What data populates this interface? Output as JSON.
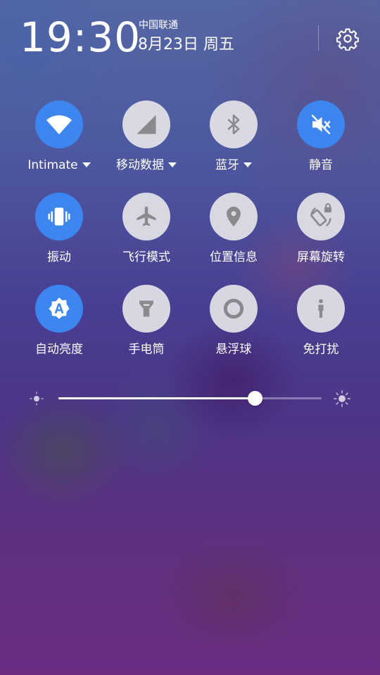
{
  "status": {
    "time": "19:30",
    "carrier": "中国联通",
    "date": "8月23日 周五",
    "settings_icon": "gear-icon"
  },
  "tiles": [
    {
      "label": "Intimate",
      "icon": "wifi-icon",
      "active": true,
      "has_dropdown": true
    },
    {
      "label": "移动数据",
      "icon": "signal-icon",
      "active": false,
      "has_dropdown": true
    },
    {
      "label": "蓝牙",
      "icon": "bluetooth-icon",
      "active": false,
      "has_dropdown": true
    },
    {
      "label": "静音",
      "icon": "mute-icon",
      "active": true,
      "has_dropdown": false
    },
    {
      "label": "振动",
      "icon": "vibrate-icon",
      "active": true,
      "has_dropdown": false
    },
    {
      "label": "飞行模式",
      "icon": "airplane-icon",
      "active": false,
      "has_dropdown": false
    },
    {
      "label": "位置信息",
      "icon": "location-icon",
      "active": false,
      "has_dropdown": false
    },
    {
      "label": "屏幕旋转",
      "icon": "rotate-lock-icon",
      "active": false,
      "has_dropdown": false
    },
    {
      "label": "自动亮度",
      "icon": "auto-brightness-icon",
      "active": true,
      "has_dropdown": false
    },
    {
      "label": "手电筒",
      "icon": "flashlight-icon",
      "active": false,
      "has_dropdown": false
    },
    {
      "label": "悬浮球",
      "icon": "floating-ball-icon",
      "active": false,
      "has_dropdown": false
    },
    {
      "label": "免打扰",
      "icon": "do-not-disturb-icon",
      "active": false,
      "has_dropdown": false
    }
  ],
  "brightness": {
    "level": 0.745,
    "min_icon": "sun-small-icon",
    "max_icon": "sun-large-icon"
  },
  "colors": {
    "active_tile": "#3d86f0",
    "inactive_tile": "#e4e4e8",
    "inactive_icon": "#8a8a8e"
  }
}
